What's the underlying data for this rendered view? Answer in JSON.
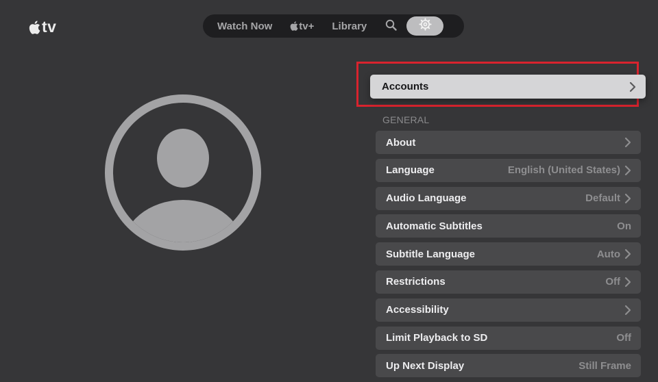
{
  "app": {
    "logo_text": "tv"
  },
  "nav": {
    "watch_now": "Watch Now",
    "appletv_plus": "tv+",
    "library": "Library"
  },
  "accounts": {
    "label": "Accounts"
  },
  "general": {
    "header": "GENERAL",
    "items": [
      {
        "label": "About",
        "value": "",
        "chevron": true
      },
      {
        "label": "Language",
        "value": "English (United States)",
        "chevron": true
      },
      {
        "label": "Audio Language",
        "value": "Default",
        "chevron": true
      },
      {
        "label": "Automatic Subtitles",
        "value": "On",
        "chevron": false
      },
      {
        "label": "Subtitle Language",
        "value": "Auto",
        "chevron": true
      },
      {
        "label": "Restrictions",
        "value": "Off",
        "chevron": true
      },
      {
        "label": "Accessibility",
        "value": "",
        "chevron": true
      },
      {
        "label": "Limit Playback to SD",
        "value": "Off",
        "chevron": false
      },
      {
        "label": "Up Next Display",
        "value": "Still Frame",
        "chevron": false
      }
    ]
  },
  "colors": {
    "background": "#363638",
    "highlight_border": "#d9232e",
    "focused_row": "#d5d5d7",
    "row": "#49494b"
  },
  "icons": {
    "logo": "apple-logo-icon",
    "search": "search-icon",
    "settings": "gear-icon",
    "row": "chevron-right-icon",
    "avatar": "user-avatar-icon"
  }
}
